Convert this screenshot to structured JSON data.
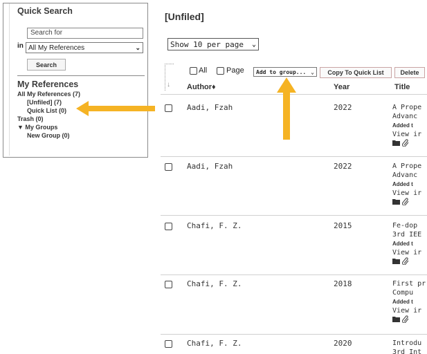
{
  "sidebar": {
    "quick_search_heading": "Quick Search",
    "search_placeholder": "Search for",
    "in_label": "in",
    "scope_selected": "All My References",
    "search_button": "Search",
    "my_references_heading": "My References",
    "tree": [
      {
        "label": "All My References (7)"
      },
      {
        "label": "[Unfiled] (7)"
      },
      {
        "label": "Quick List (0)"
      },
      {
        "label": "Trash (0)"
      },
      {
        "label": "▼ My Groups"
      },
      {
        "label": "New Group  (0)"
      }
    ]
  },
  "main": {
    "title": "[Unfiled]",
    "per_page_selected": "Show 10 per page",
    "toolbar": {
      "all_label": "All",
      "page_label": "Page",
      "add_to_group": "Add to group...",
      "copy_button": "Copy To Quick List",
      "delete_button": "Delete"
    },
    "columns": {
      "author": "Author",
      "year": "Year",
      "title": "Title"
    },
    "rows": [
      {
        "author": "Aadi, Fzah",
        "year": "2022",
        "t1": "A Prope",
        "t2": "Advanc",
        "added": "Added t",
        "view": "View ir"
      },
      {
        "author": "Aadi, Fzah",
        "year": "2022",
        "t1": "A Prope",
        "t2": "Advanc",
        "added": "Added t",
        "view": "View ir"
      },
      {
        "author": "Chafi, F. Z.",
        "year": "2015",
        "t1": "Fe-dop",
        "t2": "3rd IEE",
        "added": "Added t",
        "view": "View ir"
      },
      {
        "author": "Chafi, F. Z.",
        "year": "2018",
        "t1": "First pr",
        "t2": "Compu",
        "added": "Added t",
        "view": "View ir"
      },
      {
        "author": "Chafi, F. Z.",
        "year": "2020",
        "t1": "Introdu",
        "t2": "3rd Int",
        "added": "",
        "view": ""
      }
    ]
  },
  "colors": {
    "highlight_arrow": "#f5b324"
  }
}
